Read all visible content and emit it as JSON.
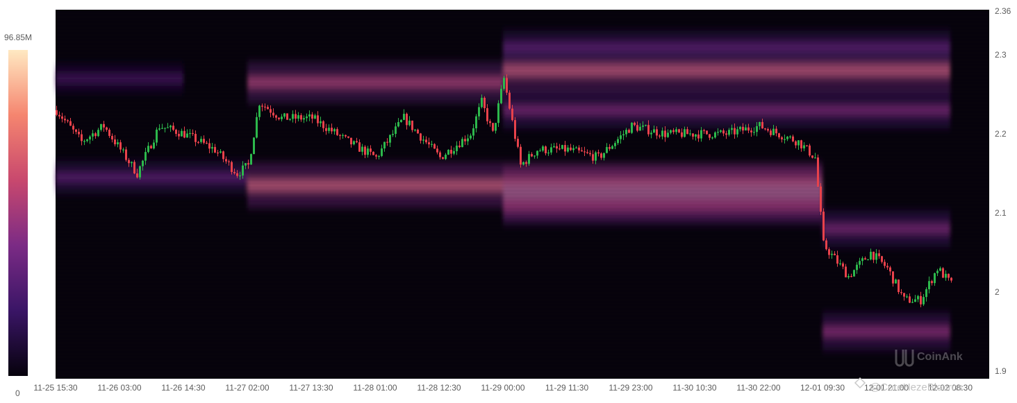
{
  "chart_data": {
    "type": "heatmap",
    "title": "",
    "xlabel": "",
    "ylabel": "",
    "ylim": [
      1.88,
      2.36
    ],
    "y_ticks": [
      2.36,
      2.3,
      2.2,
      2.1,
      2.0,
      1.9
    ],
    "x_tick_labels": [
      "11-25 15:30",
      "11-26 03:00",
      "11-26 14:30",
      "11-27 02:00",
      "11-27 13:30",
      "11-28 01:00",
      "11-28 12:30",
      "11-29 00:00",
      "11-29 11:30",
      "11-29 23:00",
      "11-30 10:30",
      "11-30 22:00",
      "12-01 09:30",
      "12-01 21:00",
      "12-02 08:30"
    ],
    "color_scale": {
      "max_label": "96.85M",
      "min_label": "0",
      "colors": [
        "#06020c",
        "#3a1566",
        "#7b2b85",
        "#c8486e",
        "#f5856f",
        "#ffe9c2"
      ]
    },
    "liquidity_bands": [
      {
        "x_start": "11-25 15:30",
        "x_end": "11-26 14:30",
        "price": 2.27,
        "intensity": 0.25
      },
      {
        "x_start": "11-27 02:00",
        "x_end": "11-29 00:00",
        "price": 2.265,
        "intensity": 0.62
      },
      {
        "x_start": "11-29 00:00",
        "x_end": "12-02 08:30",
        "price": 2.28,
        "intensity": 0.72
      },
      {
        "x_start": "11-29 00:00",
        "x_end": "12-02 08:30",
        "price": 2.31,
        "intensity": 0.35
      },
      {
        "x_start": "11-29 00:00",
        "x_end": "12-02 08:30",
        "price": 2.23,
        "intensity": 0.45
      },
      {
        "x_start": "11-25 15:30",
        "x_end": "11-27 02:00",
        "price": 2.145,
        "intensity": 0.35
      },
      {
        "x_start": "11-27 02:00",
        "x_end": "12-01 09:30",
        "price": 2.135,
        "intensity": 0.75
      },
      {
        "x_start": "11-29 00:00",
        "x_end": "12-01 09:30",
        "price": 2.125,
        "intensity": 0.95
      },
      {
        "x_start": "11-29 00:00",
        "x_end": "12-01 09:30",
        "price": 2.11,
        "intensity": 0.55
      },
      {
        "x_start": "12-01 09:30",
        "x_end": "12-02 08:30",
        "price": 2.08,
        "intensity": 0.45
      },
      {
        "x_start": "12-01 09:30",
        "x_end": "12-02 08:30",
        "price": 1.95,
        "intensity": 0.5
      }
    ],
    "price_path": [
      {
        "x": "11-25 15:30",
        "price": 2.23
      },
      {
        "x": "11-25 20:00",
        "price": 2.19
      },
      {
        "x": "11-26 00:00",
        "price": 2.21
      },
      {
        "x": "11-26 03:00",
        "price": 2.18
      },
      {
        "x": "11-26 06:00",
        "price": 2.15
      },
      {
        "x": "11-26 10:00",
        "price": 2.21
      },
      {
        "x": "11-26 14:30",
        "price": 2.2
      },
      {
        "x": "11-26 20:00",
        "price": 2.18
      },
      {
        "x": "11-27 00:00",
        "price": 2.15
      },
      {
        "x": "11-27 02:00",
        "price": 2.16
      },
      {
        "x": "11-27 04:00",
        "price": 2.24
      },
      {
        "x": "11-27 08:00",
        "price": 2.22
      },
      {
        "x": "11-27 13:30",
        "price": 2.22
      },
      {
        "x": "11-27 20:00",
        "price": 2.19
      },
      {
        "x": "11-28 01:00",
        "price": 2.17
      },
      {
        "x": "11-28 06:00",
        "price": 2.22
      },
      {
        "x": "11-28 12:30",
        "price": 2.17
      },
      {
        "x": "11-28 18:00",
        "price": 2.2
      },
      {
        "x": "11-28 20:00",
        "price": 2.24
      },
      {
        "x": "11-28 22:00",
        "price": 2.2
      },
      {
        "x": "11-29 00:00",
        "price": 2.27
      },
      {
        "x": "11-29 03:00",
        "price": 2.16
      },
      {
        "x": "11-29 06:00",
        "price": 2.18
      },
      {
        "x": "11-29 11:30",
        "price": 2.18
      },
      {
        "x": "11-29 17:00",
        "price": 2.17
      },
      {
        "x": "11-29 23:00",
        "price": 2.21
      },
      {
        "x": "11-30 05:00",
        "price": 2.2
      },
      {
        "x": "11-30 10:30",
        "price": 2.2
      },
      {
        "x": "11-30 16:00",
        "price": 2.2
      },
      {
        "x": "11-30 22:00",
        "price": 2.21
      },
      {
        "x": "12-01 05:00",
        "price": 2.19
      },
      {
        "x": "12-01 08:00",
        "price": 2.17
      },
      {
        "x": "12-01 09:30",
        "price": 2.06
      },
      {
        "x": "12-01 14:00",
        "price": 2.02
      },
      {
        "x": "12-01 18:00",
        "price": 2.05
      },
      {
        "x": "12-01 21:00",
        "price": 2.03
      },
      {
        "x": "12-02 00:00",
        "price": 1.99
      },
      {
        "x": "12-02 03:00",
        "price": 1.99
      },
      {
        "x": "12-02 06:00",
        "price": 2.03
      },
      {
        "x": "12-02 08:30",
        "price": 2.01
      }
    ],
    "candle_colors": {
      "up": "#2db84c",
      "down": "#e8424b"
    },
    "grid": false
  },
  "watermark": {
    "brand": "CoinAnk",
    "handle": "@CoreHezeBlourns"
  }
}
